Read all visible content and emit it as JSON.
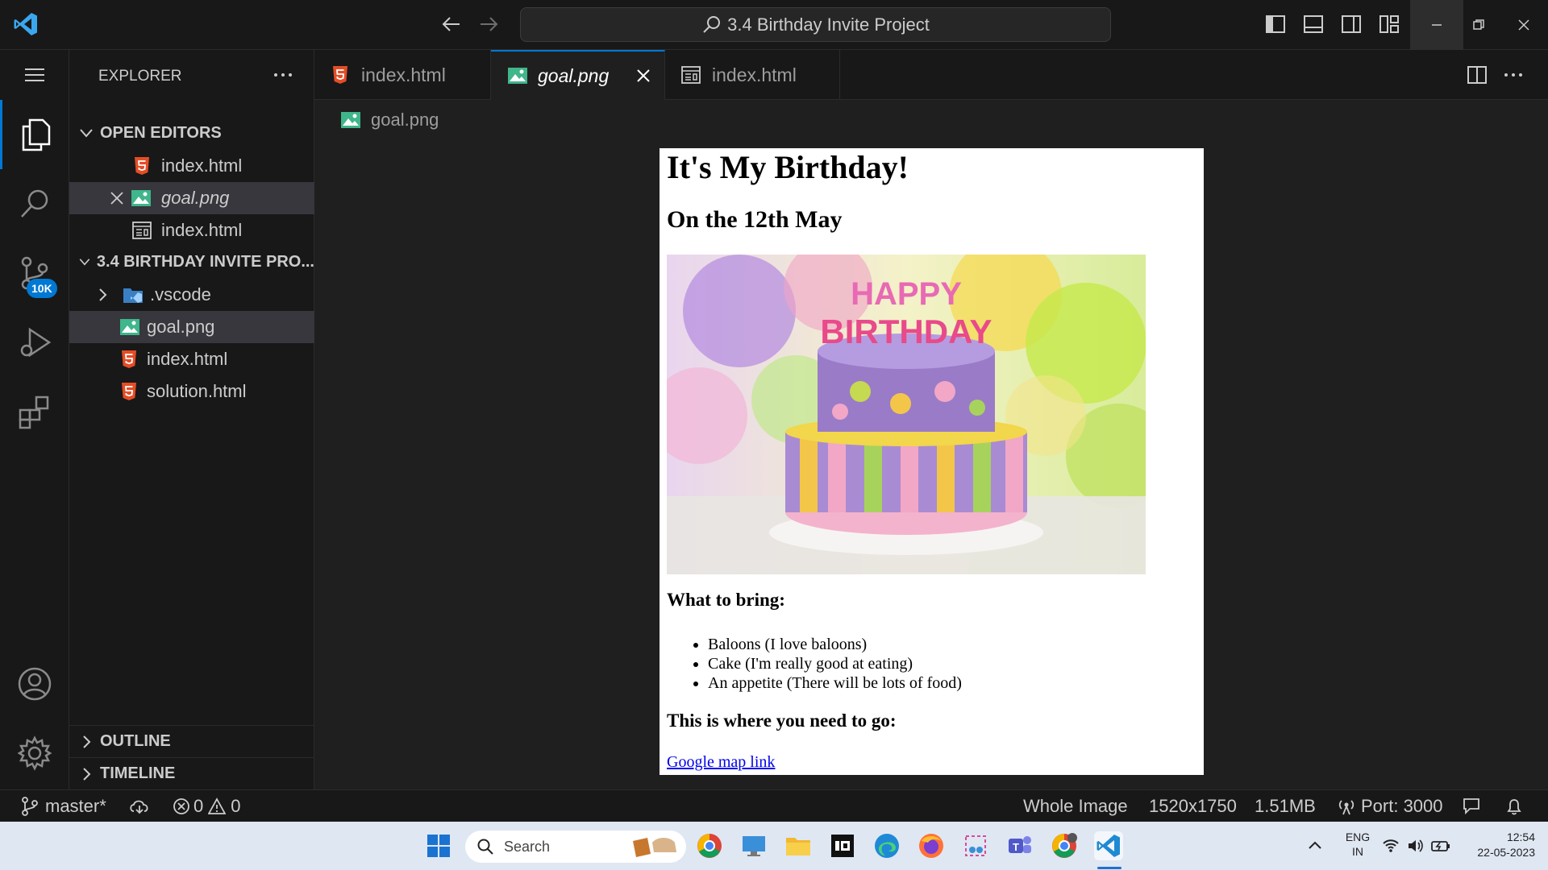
{
  "titlebar": {
    "search_text": "3.4 Birthday Invite Project"
  },
  "activity_bar": {
    "scm_badge": "10K"
  },
  "sidebar": {
    "title": "EXPLORER",
    "open_editors_label": "OPEN EDITORS",
    "open_editors": [
      {
        "label": "index.html",
        "icon": "html5-icon"
      },
      {
        "label": "goal.png",
        "icon": "image-icon"
      },
      {
        "label": "index.html",
        "icon": "preview-icon"
      }
    ],
    "project_label": "3.4 BIRTHDAY INVITE PRO...",
    "files": [
      {
        "label": ".vscode",
        "icon": "vscode-folder-icon"
      },
      {
        "label": "goal.png",
        "icon": "image-icon"
      },
      {
        "label": "index.html",
        "icon": "html5-icon"
      },
      {
        "label": "solution.html",
        "icon": "html5-icon"
      }
    ],
    "outline_label": "OUTLINE",
    "timeline_label": "TIMELINE"
  },
  "tabs": [
    {
      "label": "index.html",
      "icon": "html5-icon"
    },
    {
      "label": "goal.png",
      "icon": "image-icon",
      "active": true
    },
    {
      "label": "index.html",
      "icon": "preview-icon"
    }
  ],
  "breadcrumb": "goal.png",
  "preview": {
    "heading": "It's My Birthday!",
    "date": "On the 12th May",
    "bring_heading": "What to bring:",
    "items": [
      "Baloons (I love baloons)",
      "Cake (I'm really good at eating)",
      "An appetite (There will be lots of food)"
    ],
    "where_heading": "This is where you need to go:",
    "link": "Google map link",
    "cake_text_top": "HAPPY",
    "cake_text_bottom": "BIRTHDAY"
  },
  "statusbar": {
    "branch": "master*",
    "errors": "0",
    "warnings": "0",
    "zoom": "Whole Image",
    "dimensions": "1520x1750",
    "filesize": "1.51MB",
    "port": "Port: 3000"
  },
  "taskbar": {
    "search": "Search",
    "lang_top": "ENG",
    "lang_bottom": "IN",
    "time": "12:54",
    "date": "22-05-2023"
  },
  "colors": {
    "accent": "#0078d4",
    "html5": "#e44d26",
    "image": "#3fb68b"
  }
}
